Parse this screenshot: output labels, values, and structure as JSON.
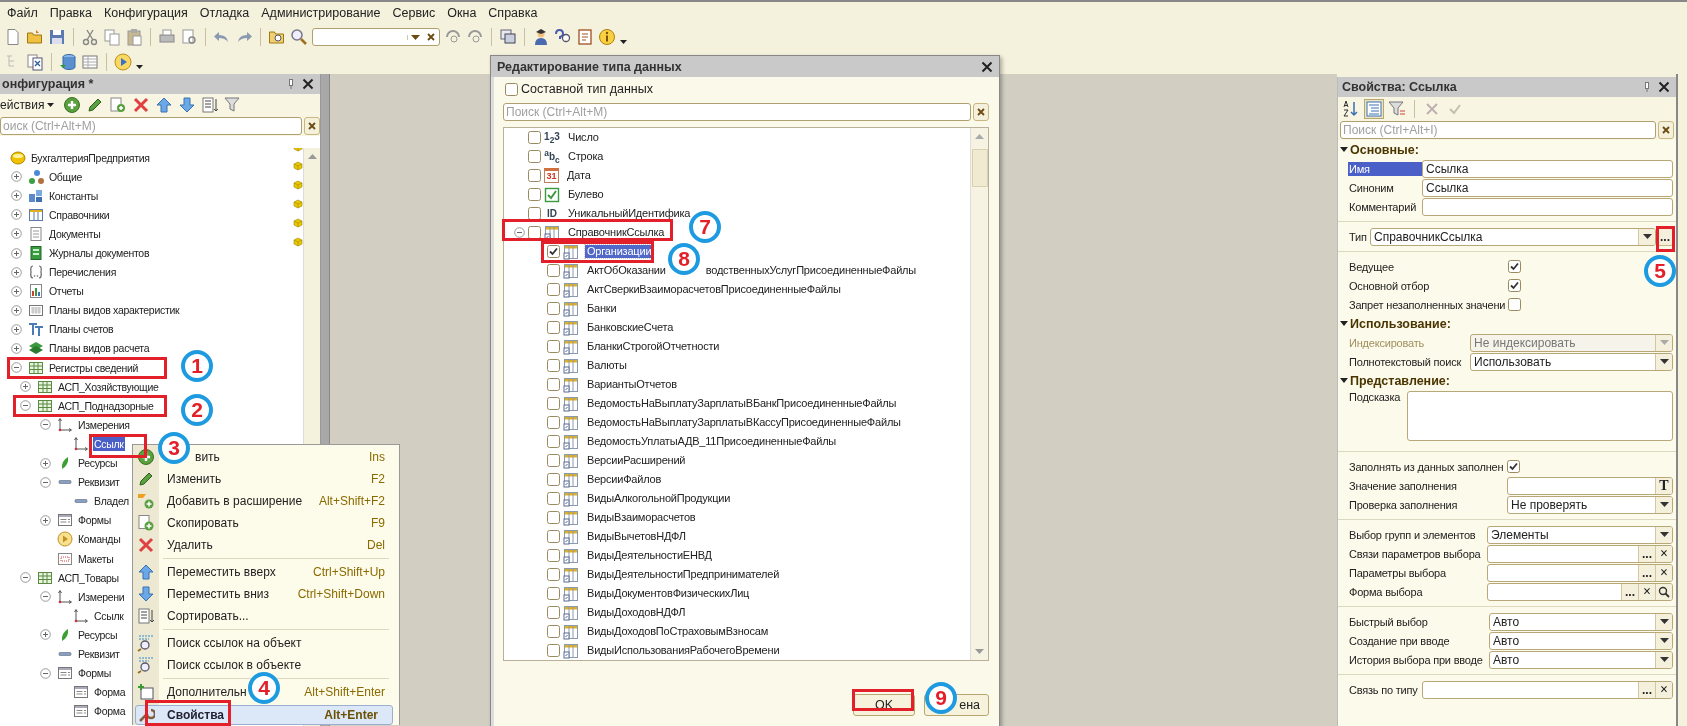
{
  "menubar": [
    "Файл",
    "Правка",
    "Конфигурация",
    "Отладка",
    "Администрирование",
    "Сервис",
    "Окна",
    "Справка"
  ],
  "config_panel": {
    "title": "онфигурация *",
    "actions_label": "ействия",
    "search": {
      "placeholder": "оиск (Ctrl+Alt+M)"
    },
    "tree": [
      {
        "label": "БухгалтерияПредприятия",
        "kind": "config",
        "selected": false,
        "marked": true,
        "children": [
          {
            "label": "Общие",
            "kind": "common",
            "expanded": false,
            "selected": false,
            "marked": true
          },
          {
            "label": "Константы",
            "kind": "constants",
            "expanded": false,
            "selected": false,
            "marked": true
          },
          {
            "label": "Справочники",
            "kind": "catalogs",
            "expanded": false,
            "selected": false,
            "marked": true
          },
          {
            "label": "Документы",
            "kind": "documents",
            "expanded": false,
            "selected": false,
            "marked": true
          },
          {
            "label": "Журналы документов",
            "kind": "journals",
            "expanded": false,
            "selected": false,
            "marked": true
          },
          {
            "label": "Перечисления",
            "kind": "enums",
            "expanded": false,
            "selected": false,
            "marked": false
          },
          {
            "label": "Отчеты",
            "kind": "reports",
            "expanded": false,
            "selected": false,
            "marked": false
          },
          {
            "label": "Планы видов характеристик",
            "kind": "chars",
            "expanded": false,
            "selected": false,
            "marked": false
          },
          {
            "label": "Планы счетов",
            "kind": "accounts",
            "expanded": false,
            "selected": false,
            "marked": false
          },
          {
            "label": "Планы видов расчета",
            "kind": "calc",
            "expanded": false,
            "selected": false,
            "marked": false
          },
          {
            "label": "Регистры сведений",
            "kind": "inforeg",
            "expanded": true,
            "selected": false,
            "marked": false,
            "children": [
              {
                "label": "АСП_Хозяйствующие",
                "kind": "inforeg",
                "expanded": false,
                "selected": false,
                "marked": false
              },
              {
                "label": "АСП_Поднадзорные",
                "kind": "inforeg",
                "expanded": true,
                "selected": false,
                "marked": false,
                "children": [
                  {
                    "label": "Измерения",
                    "kind": "dims",
                    "expanded": true,
                    "selected": false,
                    "marked": false,
                    "children": [
                      {
                        "label": "Ссылк",
                        "kind": "dim",
                        "selected": true,
                        "marked": false
                      }
                    ]
                  },
                  {
                    "label": "Ресурсы",
                    "kind": "resources",
                    "expanded": false,
                    "selected": false,
                    "marked": false
                  },
                  {
                    "label": "Реквизит",
                    "kind": "attrs",
                    "expanded": true,
                    "selected": false,
                    "marked": false,
                    "children": [
                      {
                        "label": "Владел",
                        "kind": "attr",
                        "selected": false,
                        "marked": false
                      }
                    ]
                  },
                  {
                    "label": "Формы",
                    "kind": "forms",
                    "expanded": false,
                    "selected": false,
                    "marked": false
                  },
                  {
                    "label": "Команды",
                    "kind": "commands",
                    "selected": false,
                    "marked": false
                  },
                  {
                    "label": "Макеты",
                    "kind": "templates",
                    "selected": false,
                    "marked": false
                  }
                ]
              },
              {
                "label": "АСП_Товары",
                "kind": "inforeg",
                "expanded": true,
                "selected": false,
                "marked": false,
                "children": [
                  {
                    "label": "Измерени",
                    "kind": "dims",
                    "expanded": true,
                    "selected": false,
                    "marked": false,
                    "children": [
                      {
                        "label": "Ссылк",
                        "kind": "dim",
                        "selected": false,
                        "marked": false
                      }
                    ]
                  },
                  {
                    "label": "Ресурсы",
                    "kind": "resources",
                    "expanded": false,
                    "selected": false,
                    "marked": false
                  },
                  {
                    "label": "Реквизит",
                    "kind": "attrs",
                    "selected": false,
                    "marked": false
                  },
                  {
                    "label": "Формы",
                    "kind": "forms",
                    "expanded": true,
                    "selected": false,
                    "marked": false,
                    "children": [
                      {
                        "label": "Форма",
                        "kind": "form",
                        "selected": false,
                        "marked": false
                      },
                      {
                        "label": "Форма",
                        "kind": "form",
                        "selected": false,
                        "marked": false
                      }
                    ]
                  }
                ]
              }
            ]
          }
        ]
      }
    ]
  },
  "context_menu": [
    {
      "label": "вить",
      "shortcut": "Ins",
      "kind": "add",
      "selected": false,
      "separator_before": false
    },
    {
      "label": "Изменить",
      "shortcut": "F2",
      "kind": "edit",
      "selected": false,
      "separator_before": false
    },
    {
      "label": "Добавить в расширение",
      "shortcut": "Alt+Shift+F2",
      "kind": "extend",
      "selected": false,
      "separator_before": false
    },
    {
      "label": "Скопировать",
      "shortcut": "F9",
      "kind": "copy",
      "selected": false,
      "separator_before": false
    },
    {
      "label": "Удалить",
      "shortcut": "Del",
      "kind": "delete",
      "selected": false,
      "separator_before": false
    },
    {
      "label": "Переместить вверх",
      "shortcut": "Ctrl+Shift+Up",
      "kind": "up",
      "selected": false,
      "separator_before": true
    },
    {
      "label": "Переместить вниз",
      "shortcut": "Ctrl+Shift+Down",
      "kind": "down",
      "selected": false,
      "separator_before": false
    },
    {
      "label": "Сортировать...",
      "kind": "sort",
      "selected": false,
      "separator_before": false
    },
    {
      "label": "Поиск ссылок на объект",
      "kind": "find_refs",
      "selected": false,
      "separator_before": true
    },
    {
      "label": "Поиск ссылок в объекте",
      "kind": "find_in",
      "selected": false,
      "separator_before": false
    },
    {
      "label": "Дополнительн",
      "shortcut": "Alt+Shift+Enter",
      "kind": "more",
      "selected": false,
      "separator_before": true
    },
    {
      "label": "Свойства",
      "shortcut": "Alt+Enter",
      "kind": "props",
      "selected": true,
      "separator_before": false
    }
  ],
  "type_dialog": {
    "title": "Редактирование типа данных",
    "composite": {
      "label": "Составной тип данных",
      "checked": false
    },
    "search": {
      "placeholder": "Поиск (Ctrl+Alt+M)"
    },
    "types": [
      {
        "label": "Число",
        "kind": "number",
        "glyph": "1$_{2}$3",
        "checked": false,
        "selected": false
      },
      {
        "label": "Строка",
        "kind": "string",
        "glyph": "$^{a}$b$_{c}$",
        "checked": false,
        "selected": false
      },
      {
        "label": "Дата",
        "kind": "date",
        "glyph": "31",
        "checked": false,
        "selected": false
      },
      {
        "label": "Булево",
        "kind": "boolean",
        "checked": false,
        "selected": false
      },
      {
        "label": "УникальныйИдентифика",
        "kind": "uuid",
        "glyph": "ID",
        "checked": false,
        "selected": false
      },
      {
        "label": "СправочникСсылка",
        "kind": "catalog",
        "expanded": true,
        "checked": false,
        "selected": false,
        "children": [
          {
            "label": "Организации",
            "kind": "catalog",
            "checked": true,
            "selected": true
          },
          {
            "parts": [
              "АктОбОказании",
              "водственныхУслугПрисоединенныеФайлы"
            ],
            "kind": "catalog",
            "checked": false,
            "selected": false
          },
          {
            "label": "АктСверкиВзаиморасчетовПрисоединенныеФайлы",
            "kind": "catalog",
            "checked": false,
            "selected": false
          },
          {
            "label": "Банки",
            "kind": "catalog",
            "checked": false,
            "selected": false
          },
          {
            "label": "БанковскиеСчета",
            "kind": "catalog",
            "checked": false,
            "selected": false
          },
          {
            "label": "БланкиСтрогойОтчетности",
            "kind": "catalog",
            "checked": false,
            "selected": false
          },
          {
            "label": "Валюты",
            "kind": "catalog",
            "checked": false,
            "selected": false
          },
          {
            "label": "ВариантыОтчетов",
            "kind": "catalog",
            "checked": false,
            "selected": false
          },
          {
            "label": "ВедомостьНаВыплатуЗарплатыВБанкПрисоединенныеФайлы",
            "kind": "catalog",
            "checked": false,
            "selected": false
          },
          {
            "label": "ВедомостьНаВыплатуЗарплатыВКассуПрисоединенныеФайлы",
            "kind": "catalog",
            "checked": false,
            "selected": false
          },
          {
            "label": "ВедомостьУплатыАДВ_11ПрисоединенныеФайлы",
            "kind": "catalog",
            "checked": false,
            "selected": false
          },
          {
            "label": "ВерсииРасширений",
            "kind": "catalog",
            "checked": false,
            "selected": false
          },
          {
            "label": "ВерсииФайлов",
            "kind": "catalog",
            "checked": false,
            "selected": false
          },
          {
            "label": "ВидыАлкогольнойПродукции",
            "kind": "catalog",
            "checked": false,
            "selected": false
          },
          {
            "label": "ВидыВзаиморасчетов",
            "kind": "catalog",
            "checked": false,
            "selected": false
          },
          {
            "label": "ВидыВычетовНДФЛ",
            "kind": "catalog",
            "checked": false,
            "selected": false
          },
          {
            "label": "ВидыДеятельностиЕНВД",
            "kind": "catalog",
            "checked": false,
            "selected": false
          },
          {
            "label": "ВидыДеятельностиПредпринимателей",
            "kind": "catalog",
            "checked": false,
            "selected": false
          },
          {
            "label": "ВидыДокументовФизическихЛиц",
            "kind": "catalog",
            "checked": false,
            "selected": false
          },
          {
            "label": "ВидыДоходовНДФЛ",
            "kind": "catalog",
            "checked": false,
            "selected": false
          },
          {
            "label": "ВидыДоходовПоСтраховымВзносам",
            "kind": "catalog",
            "checked": false,
            "selected": false
          },
          {
            "label": "ВидыИспользованияРабочегоВремени",
            "kind": "catalog",
            "checked": false,
            "selected": false
          }
        ]
      }
    ],
    "buttons": [
      {
        "label": "OK"
      },
      {
        "label": "ена"
      }
    ]
  },
  "properties_panel": {
    "title": "Свойства: Ссылка",
    "search": {
      "placeholder": "Поиск (Ctrl+Alt+I)"
    },
    "groups": [
      {
        "title": "Основные:",
        "rows": [
          {
            "kind": "text",
            "label": "Имя",
            "value": "Ссылка",
            "selected": true,
            "disabled": false
          },
          {
            "kind": "text",
            "label": "Синоним",
            "value": "Ссылка",
            "selected": false,
            "disabled": false
          },
          {
            "kind": "text",
            "label": "Комментарий",
            "selected": false,
            "disabled": false
          }
        ]
      },
      {
        "rows": [
          {
            "kind": "select",
            "label": "Тип",
            "value": "СправочникСсылка",
            "selected": false,
            "disabled": false,
            "buttons": [
              {
                "kind": "text",
                "text": "..."
              }
            ]
          }
        ]
      },
      {
        "rows": [
          {
            "kind": "checkbox",
            "label": "Ведущее",
            "checked": true,
            "selected": false,
            "disabled": false
          },
          {
            "kind": "checkbox",
            "label": "Основной отбор",
            "checked": true,
            "selected": false,
            "disabled": false
          },
          {
            "kind": "checkbox",
            "label": "Запрет незаполненных значени",
            "checked": false,
            "selected": false,
            "disabled": false
          }
        ]
      },
      {
        "title": "Использование:",
        "rows": [
          {
            "kind": "select",
            "label": "Индексировать",
            "value": "Не индексировать",
            "selected": false,
            "disabled": true
          },
          {
            "kind": "select",
            "label": "Полнотекстовый поиск",
            "value": "Использовать",
            "selected": false,
            "disabled": false
          }
        ]
      },
      {
        "title": "Представление:",
        "rows": [
          {
            "kind": "textarea",
            "label": "Подсказка",
            "selected": false,
            "disabled": false
          }
        ]
      },
      {
        "rows": [
          {
            "kind": "checkbox",
            "label": "Заполнять из данных заполнен",
            "checked": true,
            "selected": false,
            "disabled": false
          },
          {
            "kind": "text",
            "label": "Значение заполнения",
            "selected": false,
            "disabled": false,
            "buttons": [
              {
                "kind": "text",
                "text": "T"
              }
            ]
          },
          {
            "kind": "select",
            "label": "Проверка заполнения",
            "value": "Не проверять",
            "selected": false,
            "disabled": false
          }
        ]
      },
      {
        "rows": [
          {
            "kind": "select",
            "label": "Выбор групп и элементов",
            "value": "Элементы",
            "selected": false,
            "disabled": false
          },
          {
            "kind": "text",
            "label": "Связи параметров выбора",
            "selected": false,
            "disabled": false,
            "buttons": [
              {
                "kind": "text",
                "text": "..."
              },
              {
                "kind": "text",
                "text": "×"
              }
            ]
          },
          {
            "kind": "text",
            "label": "Параметры выбора",
            "selected": false,
            "disabled": false,
            "buttons": [
              {
                "kind": "text",
                "text": "..."
              },
              {
                "kind": "text",
                "text": "×"
              }
            ]
          },
          {
            "kind": "text",
            "label": "Форма выбора",
            "selected": false,
            "disabled": false,
            "buttons": [
              {
                "kind": "text",
                "text": "..."
              },
              {
                "kind": "text",
                "text": "×"
              },
              {
                "kind": "search"
              }
            ]
          }
        ]
      },
      {
        "rows": [
          {
            "kind": "select",
            "label": "Быстрый выбор",
            "value": "Авто",
            "selected": false,
            "disabled": false
          },
          {
            "kind": "select",
            "label": "Создание при вводе",
            "value": "Авто",
            "selected": false,
            "disabled": false
          },
          {
            "kind": "select",
            "label": "История выбора при вводе",
            "value": "Авто",
            "selected": false,
            "disabled": false
          }
        ]
      },
      {
        "rows": [
          {
            "kind": "text",
            "label": "Связь по типу",
            "selected": false,
            "disabled": false,
            "buttons": [
              {
                "kind": "text",
                "text": "..."
              },
              {
                "kind": "text",
                "text": "×"
              }
            ]
          }
        ]
      }
    ]
  },
  "annotations": [
    {
      "number": "1"
    },
    {
      "number": "2"
    },
    {
      "number": "3"
    },
    {
      "number": "4"
    },
    {
      "number": "5"
    },
    {
      "number": "7"
    },
    {
      "number": "8"
    },
    {
      "number": "9"
    }
  ]
}
